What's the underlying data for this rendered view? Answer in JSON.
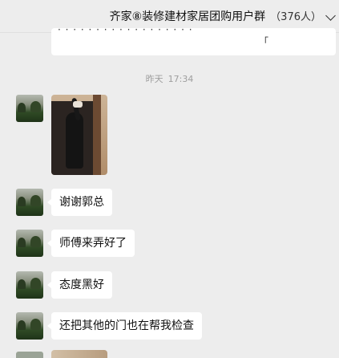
{
  "header": {
    "title": "齐家⑧装修建材家居团购用户群",
    "member_count": "（376人）"
  },
  "previous_message": {
    "partial_text": "· · · · · · · · · · · · · · · · · ·",
    "partial_mark": "「"
  },
  "timestamp": {
    "day": "昨天",
    "time": "17:34"
  },
  "messages": [
    {
      "type": "image"
    },
    {
      "type": "text",
      "text": "谢谢郭总"
    },
    {
      "type": "text",
      "text": "师傅来弄好了"
    },
    {
      "type": "text",
      "text": "态度黑好"
    },
    {
      "type": "text",
      "text": "还把其他的门也在帮我检查"
    }
  ]
}
